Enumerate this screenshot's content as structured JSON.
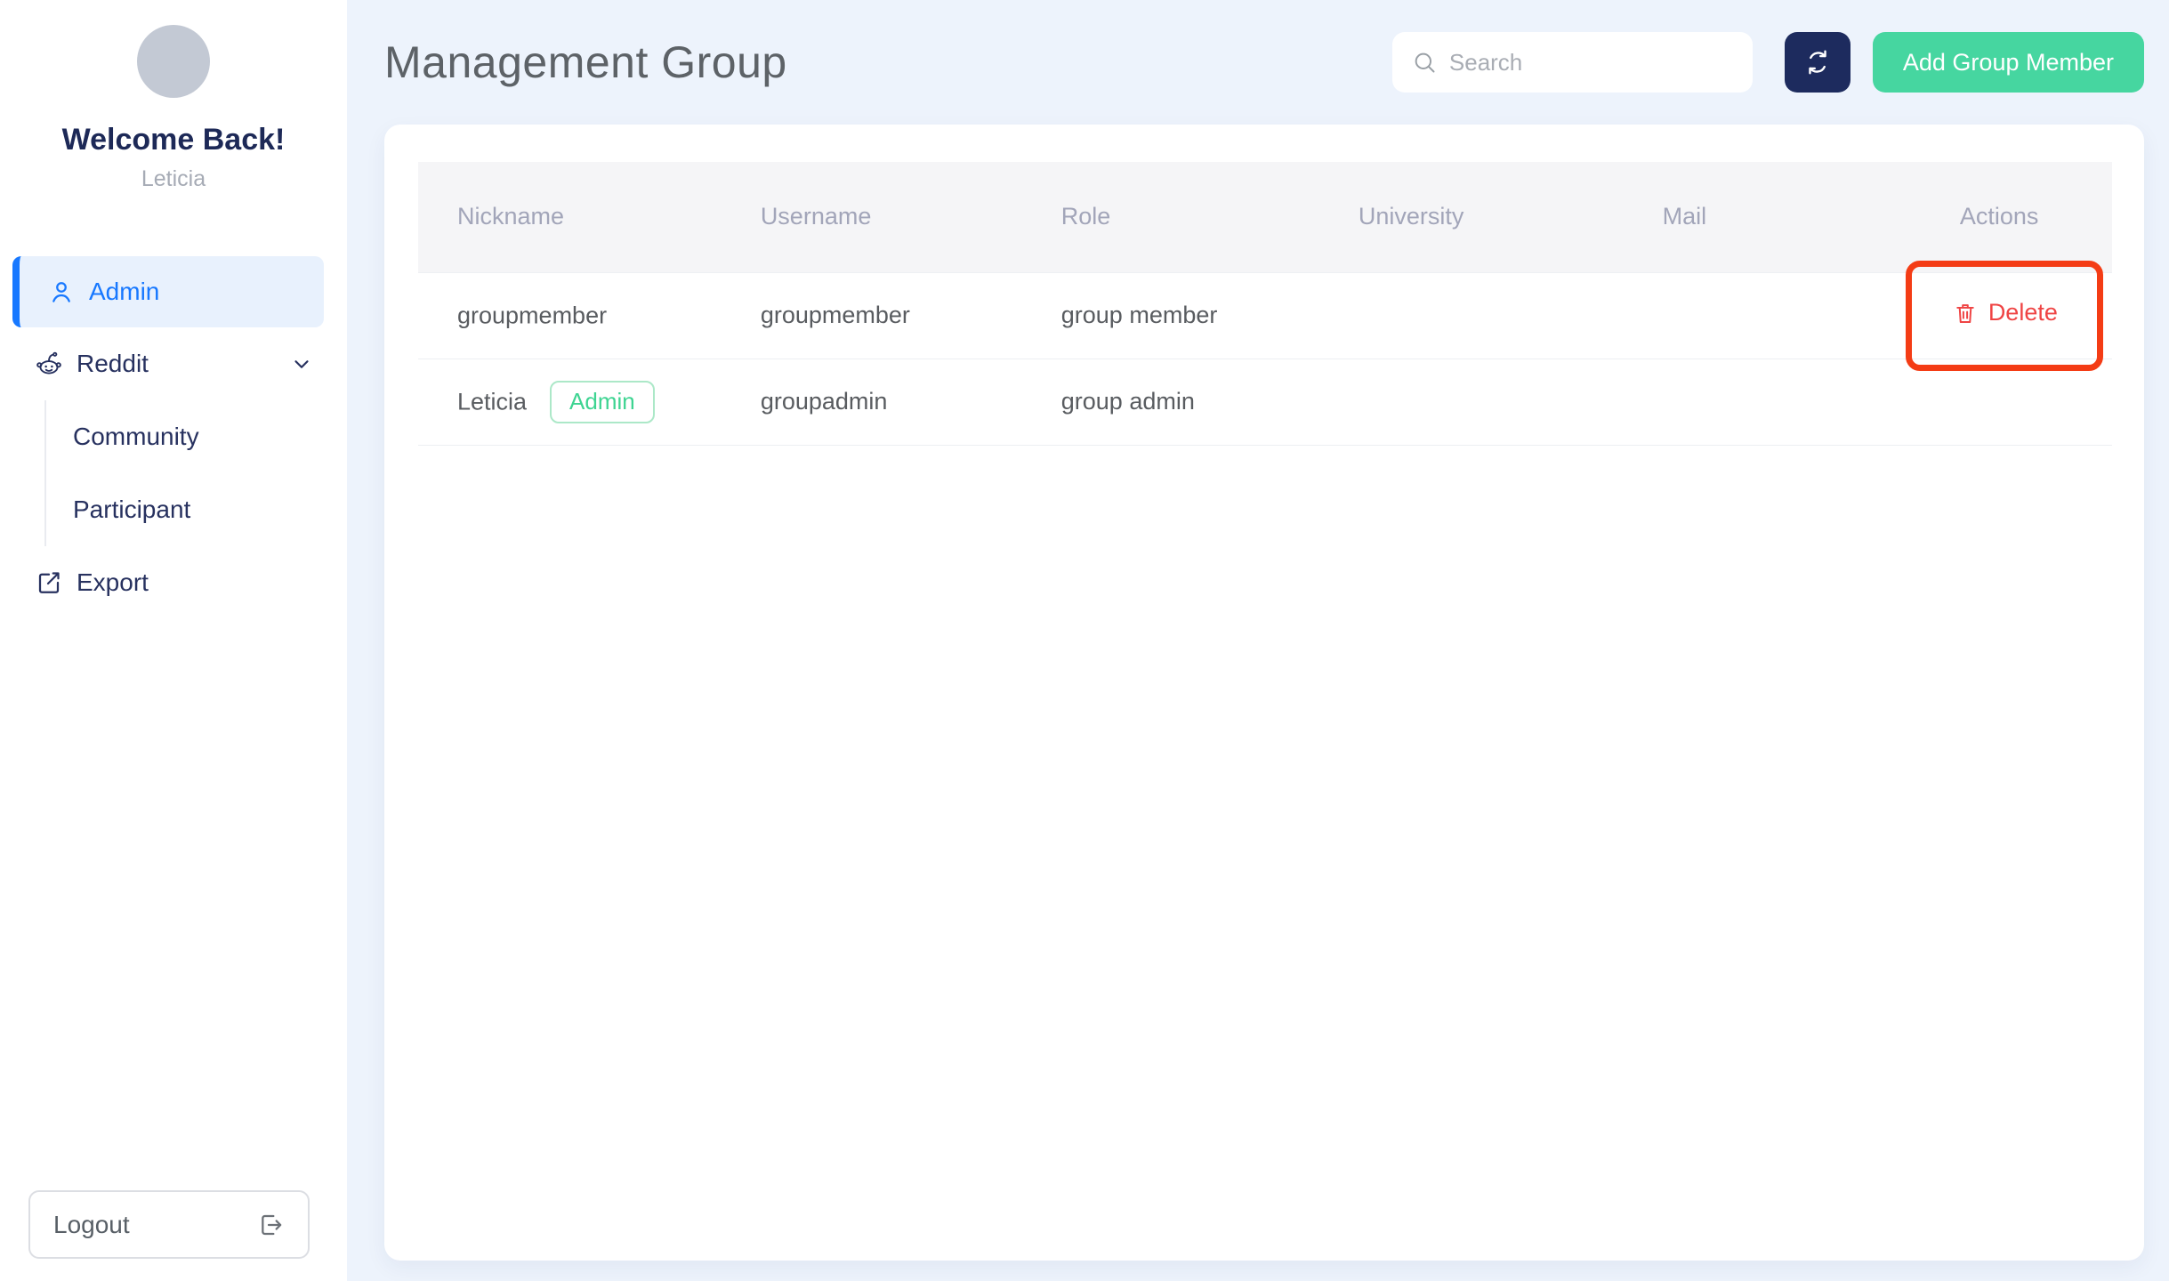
{
  "sidebar": {
    "welcome": "Welcome Back!",
    "username": "Leticia",
    "menu": {
      "admin": "Admin",
      "reddit": "Reddit",
      "community": "Community",
      "participant": "Participant",
      "export": "Export"
    },
    "logout": "Logout"
  },
  "header": {
    "title": "Management Group",
    "search_placeholder": "Search",
    "add_button": "Add Group Member"
  },
  "table": {
    "columns": [
      "Nickname",
      "Username",
      "Role",
      "University",
      "Mail",
      "Actions"
    ],
    "rows": [
      {
        "nickname": "groupmember",
        "badge": "",
        "username": "groupmember",
        "role": "group member",
        "university": "",
        "mail": "",
        "action": "Delete"
      },
      {
        "nickname": "Leticia",
        "badge": "Admin",
        "username": "groupadmin",
        "role": "group admin",
        "university": "",
        "mail": "",
        "action": ""
      }
    ]
  },
  "icons": {
    "sidebar_admin": "user-icon",
    "sidebar_reddit": "reddit-icon",
    "sidebar_reddit_expand": "chevron-down-icon",
    "sidebar_export": "export-icon",
    "logout": "logout-icon",
    "search": "search-icon",
    "refresh": "refresh-icon",
    "delete": "trash-icon"
  },
  "annotation": {
    "type": "highlight-box",
    "target": "delete-button",
    "color": "#f43c15"
  },
  "colors": {
    "accent_blue": "#1778ff",
    "navy": "#1d2b5e",
    "green": "#46d6a0",
    "delete_red": "#ef4444",
    "badge_green": "#3ed492",
    "main_background": "#edf3fc",
    "header_row_bg": "#f5f5f7"
  }
}
